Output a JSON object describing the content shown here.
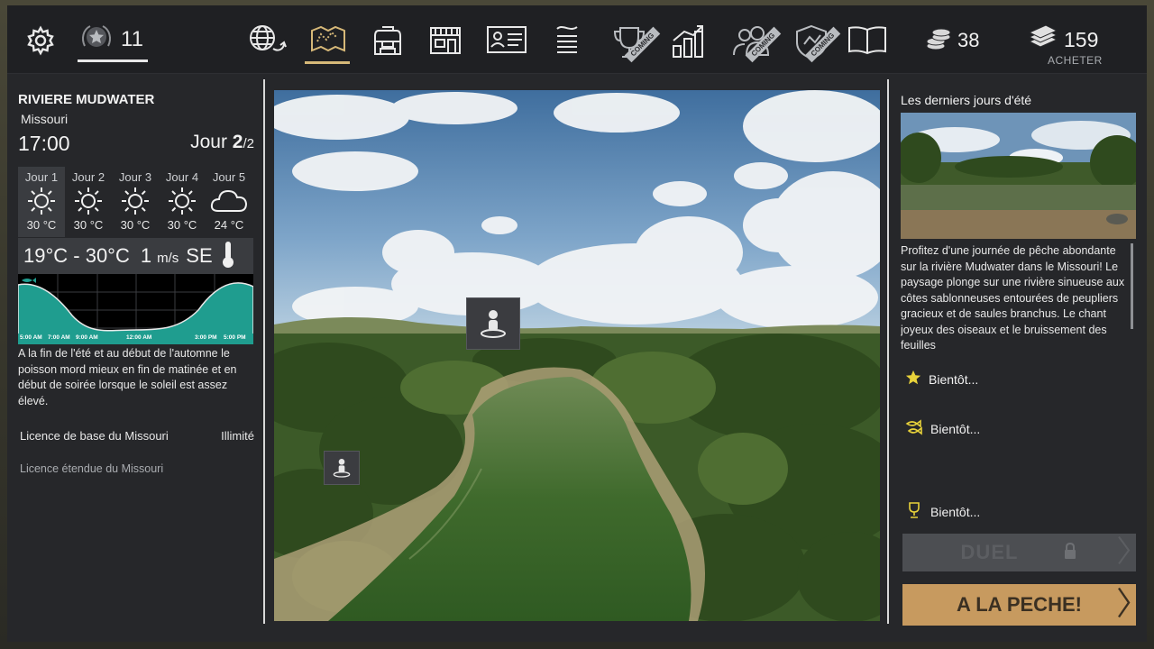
{
  "topbar": {
    "level": "11",
    "coins": "38",
    "cash": "159",
    "buy_label": "ACHETER",
    "nav_icons": [
      "globe-icon",
      "map-icon",
      "backpack-icon",
      "shop-icon",
      "license-icon",
      "checklist-icon",
      "trophy-icon",
      "stats-icon",
      "friends-icon",
      "shield-icon",
      "book-icon"
    ],
    "soon_badge": "COMING"
  },
  "location": {
    "title": "RIVIERE MUDWATER",
    "state": "Missouri",
    "time": "17:00",
    "day_label": "Jour",
    "day_current": "2",
    "day_total": "/2"
  },
  "forecast": [
    {
      "day": "Jour 1",
      "temp": "30 °C",
      "icon": "sun-icon"
    },
    {
      "day": "Jour 2",
      "temp": "30 °C",
      "icon": "sun-icon"
    },
    {
      "day": "Jour 3",
      "temp": "30 °C",
      "icon": "sun-icon"
    },
    {
      "day": "Jour 4",
      "temp": "30 °C",
      "icon": "sun-icon"
    },
    {
      "day": "Jour 5",
      "temp": "24 °C",
      "icon": "cloud-icon"
    }
  ],
  "conditions": {
    "temp_range": "19°C - 30°C",
    "wind_speed": "1",
    "wind_unit": "m/s",
    "wind_dir": "SE"
  },
  "activity_graph": {
    "labels": [
      "5:00 AM",
      "7:00 AM",
      "9:00 AM",
      "12:00 AM",
      "3:00 PM",
      "5:00 PM"
    ],
    "color": "#1f9d8f"
  },
  "left_desc": "A la fin de l'été et au début de l'automne le poisson mord mieux en fin de matinée et en début de soirée lorsque le soleil est assez élevé.",
  "licenses": {
    "base_label": "Licence de base du Missouri",
    "base_value": "Illimité",
    "extended_label": "Licence étendue du Missouri"
  },
  "event": {
    "title": "Les derniers jours d'été",
    "desc": "Profitez d'une journée de pêche abondante sur la rivière Mudwater dans le Missouri! Le paysage plonge sur une rivière sinueuse aux côtes sablonneuses entourées de peupliers gracieux et de saules branchus. Le chant joyeux des oiseaux et le  bruissement des feuilles"
  },
  "soon_items": [
    {
      "label": "Bientôt...",
      "icon": "star-icon"
    },
    {
      "label": "Bientôt...",
      "icon": "fish-icon"
    },
    {
      "label": "Bientôt...",
      "icon": "trophy-icon"
    }
  ],
  "buttons": {
    "duel": "DUEL",
    "fish": "A LA PECHE!"
  },
  "colors": {
    "accent_gold": "#c79a5f",
    "panel": "#26272a",
    "graph_fill": "#1f9d8f",
    "star_yellow": "#e8d23a"
  }
}
